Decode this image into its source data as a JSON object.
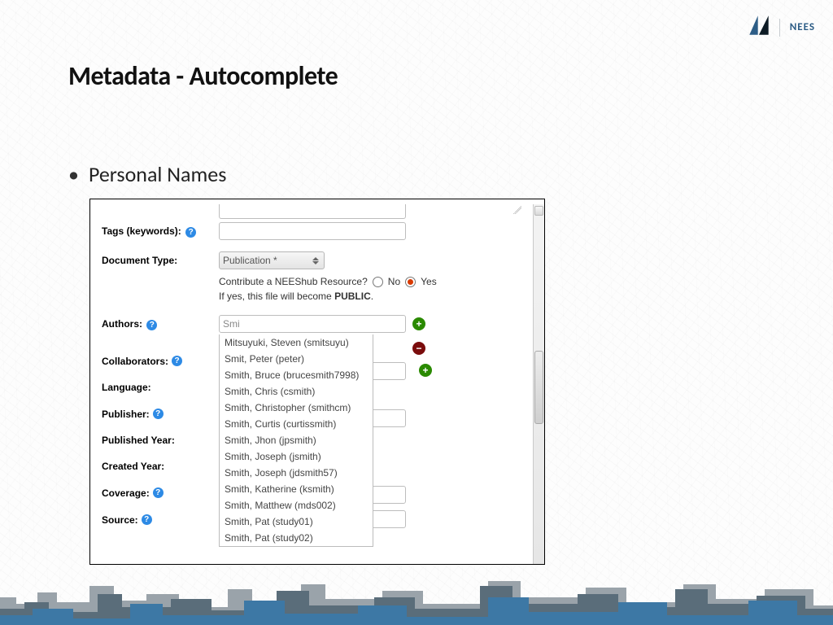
{
  "brand": {
    "text": "NEES"
  },
  "slide": {
    "title": "Metadata - Autocomplete",
    "bullet": "Personal Names"
  },
  "form": {
    "tags_label": "Tags (keywords):",
    "doc_type_label": "Document Type:",
    "doc_type_value": "Publication *",
    "contribute_question": "Contribute a NEEShub Resource?",
    "contribute_no": "No",
    "contribute_yes": "Yes",
    "contribute_note_prefix": "If yes, this file will become ",
    "contribute_note_bold": "PUBLIC",
    "authors_label": "Authors:",
    "authors_value": "Smi",
    "collaborators_label": "Collaborators:",
    "language_label": "Language:",
    "publisher_label": "Publisher:",
    "published_year_label": "Published Year:",
    "created_year_label": "Created Year:",
    "coverage_label": "Coverage:",
    "source_label": "Source:"
  },
  "autocomplete": {
    "items": [
      "Mitsuyuki, Steven (smitsuyu)",
      "Smit, Peter (peter)",
      "Smith, Bruce (brucesmith7998)",
      "Smith, Chris (csmith)",
      "Smith, Christopher (smithcm)",
      "Smith, Curtis (curtissmith)",
      "Smith, Jhon (jpsmith)",
      "Smith, Joseph (jsmith)",
      "Smith, Joseph (jdsmith57)",
      "Smith, Katherine (ksmith)",
      "Smith, Matthew (mds002)",
      "Smith, Pat (study01)",
      "Smith, Pat (study02)"
    ]
  }
}
